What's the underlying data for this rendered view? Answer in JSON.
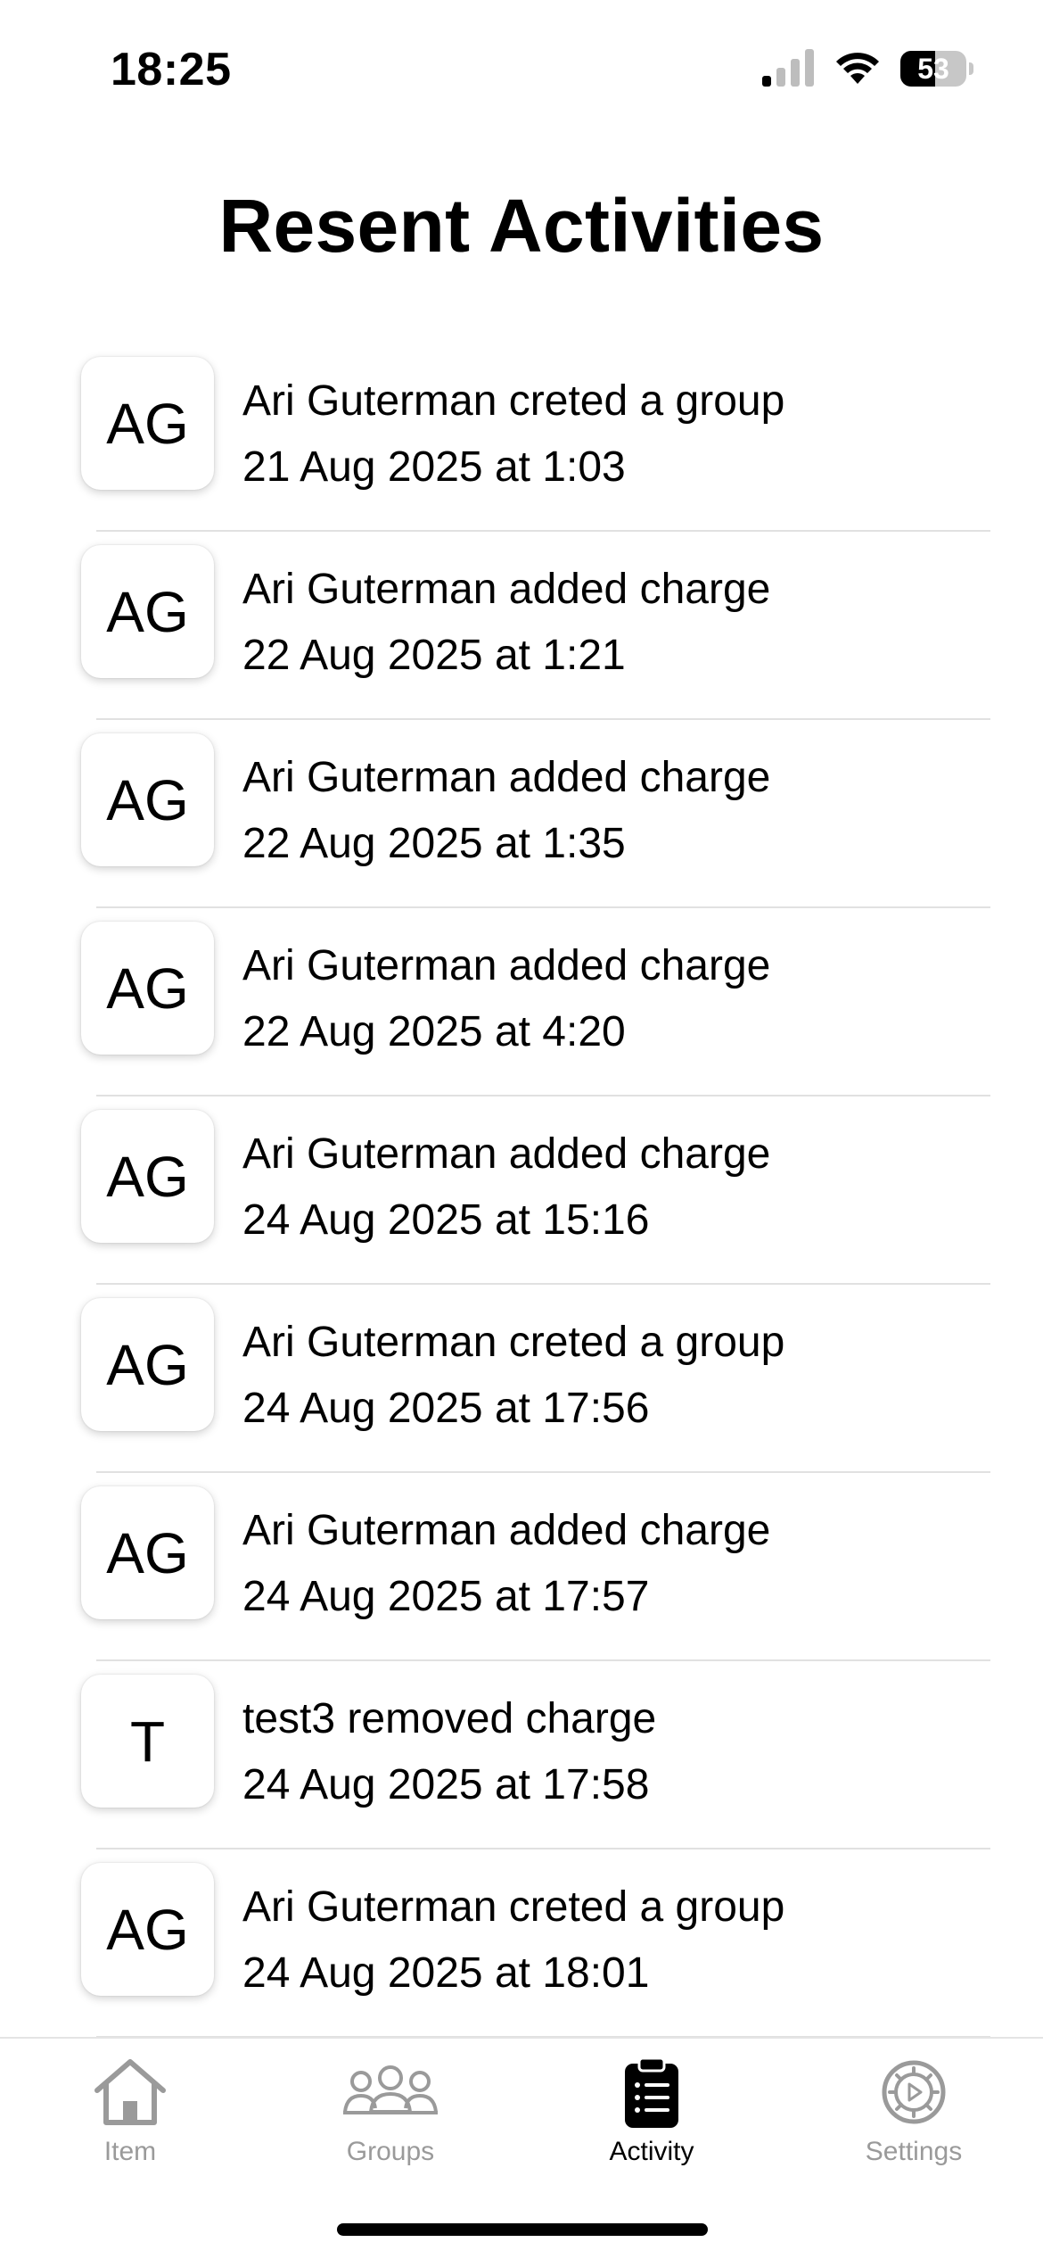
{
  "status_bar": {
    "time": "18:25",
    "battery_level": "53",
    "battery_fraction": 0.53
  },
  "header": {
    "title": "Resent Activities"
  },
  "activities": [
    {
      "initials": "AG",
      "text": "Ari Guterman creted a group",
      "date": "21 Aug 2025 at 1:03"
    },
    {
      "initials": "AG",
      "text": "Ari Guterman added charge",
      "date": "22 Aug 2025 at 1:21"
    },
    {
      "initials": "AG",
      "text": "Ari Guterman added charge",
      "date": "22 Aug 2025 at 1:35"
    },
    {
      "initials": "AG",
      "text": "Ari Guterman added charge",
      "date": "22 Aug 2025 at 4:20"
    },
    {
      "initials": "AG",
      "text": "Ari Guterman added charge",
      "date": "24 Aug 2025 at 15:16"
    },
    {
      "initials": "AG",
      "text": "Ari Guterman creted a group",
      "date": "24 Aug 2025 at 17:56"
    },
    {
      "initials": "AG",
      "text": "Ari Guterman added charge",
      "date": "24 Aug 2025 at 17:57"
    },
    {
      "initials": "T",
      "text": "test3 removed charge",
      "date": "24 Aug 2025 at 17:58"
    },
    {
      "initials": "AG",
      "text": "Ari Guterman creted a group",
      "date": "24 Aug 2025 at 18:01"
    }
  ],
  "tab_bar": {
    "tabs": [
      {
        "label": "Item",
        "icon": "house-icon",
        "active": false
      },
      {
        "label": "Groups",
        "icon": "people-icon",
        "active": false
      },
      {
        "label": "Activity",
        "icon": "clipboard-list-icon",
        "active": true
      },
      {
        "label": "Settings",
        "icon": "gear-icon",
        "active": false
      }
    ]
  },
  "colors": {
    "accent_active": "#000000",
    "inactive": "#9a9a9a",
    "divider": "#e1e1e1"
  }
}
